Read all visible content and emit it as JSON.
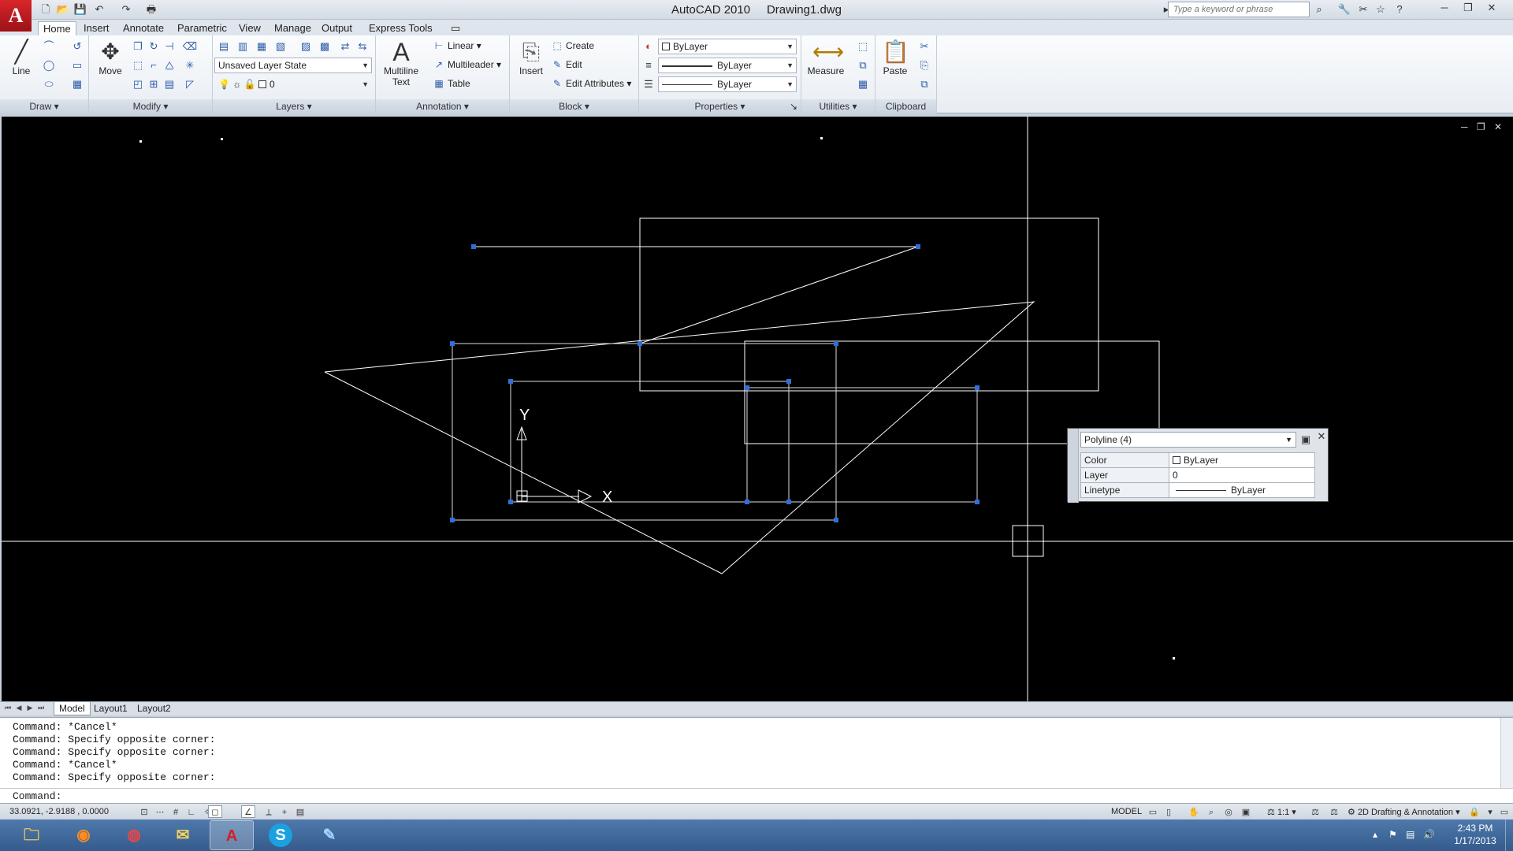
{
  "app": {
    "title": "AutoCAD 2010",
    "document": "Drawing1.dwg",
    "logo_letter": "A",
    "search_placeholder": "Type a keyword or phrase"
  },
  "tabs": [
    "Home",
    "Insert",
    "Annotate",
    "Parametric",
    "View",
    "Manage",
    "Output",
    "Express Tools"
  ],
  "ribbon": {
    "draw": {
      "title": "Draw",
      "line": "Line"
    },
    "modify": {
      "title": "Modify",
      "move": "Move"
    },
    "layers": {
      "title": "Layers",
      "layer_state": "Unsaved Layer State",
      "current_layer": "0"
    },
    "annotation": {
      "title": "Annotation",
      "multiline": "Multiline",
      "text": "Text",
      "linear": "Linear",
      "multileader": "Multileader",
      "table": "Table"
    },
    "block": {
      "title": "Block",
      "insert": "Insert",
      "create": "Create",
      "edit": "Edit",
      "edit_attributes": "Edit Attributes"
    },
    "properties": {
      "title": "Properties",
      "color": "ByLayer",
      "linetype": "ByLayer",
      "lineweight": "ByLayer"
    },
    "utilities": {
      "title": "Utilities",
      "measure": "Measure"
    },
    "clipboard": {
      "title": "Clipboard",
      "paste": "Paste"
    }
  },
  "quick_properties": {
    "selection": "Polyline (4)",
    "rows": [
      {
        "key": "Color",
        "value": "ByLayer"
      },
      {
        "key": "Layer",
        "value": "0"
      },
      {
        "key": "Linetype",
        "value": "ByLayer"
      }
    ]
  },
  "ucs": {
    "x_label": "X",
    "y_label": "Y"
  },
  "layout_tabs": [
    "Model",
    "Layout1",
    "Layout2"
  ],
  "command_history": [
    "Command: *Cancel*",
    "Command: Specify opposite corner:",
    "Command: Specify opposite corner:",
    "Command: *Cancel*",
    "Command: Specify opposite corner:"
  ],
  "command_prompt": "Command:",
  "status": {
    "coordinates": "33.0921, -2.9188 , 0.0000",
    "space": "MODEL",
    "annotation_scale": "1:1",
    "workspace": "2D Drafting & Annotation"
  },
  "clock": {
    "time": "2:43 PM",
    "date": "1/17/2013"
  },
  "taskbar_apps": [
    "file-explorer",
    "firefox",
    "chrome",
    "outlook",
    "autocad",
    "skype",
    "notepad"
  ],
  "colors": {
    "canvas": "#000000",
    "grip": "#2f6fd8",
    "geometry": "#ffffff",
    "logo": "#c8161d"
  }
}
